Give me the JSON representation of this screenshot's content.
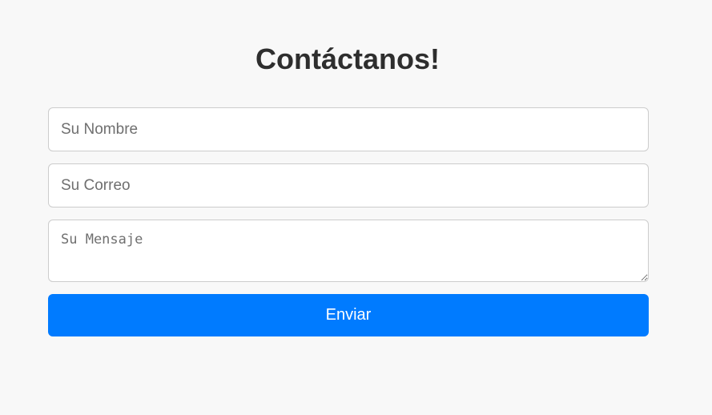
{
  "page": {
    "title": "Contáctanos!"
  },
  "form": {
    "name_placeholder": "Su Nombre",
    "email_placeholder": "Su Correo",
    "message_placeholder": "Su Mensaje",
    "submit_label": "Enviar"
  },
  "colors": {
    "background": "#f8f8f8",
    "title": "#2e2e2e",
    "accent": "#007bff",
    "field_border": "#cccccc"
  }
}
